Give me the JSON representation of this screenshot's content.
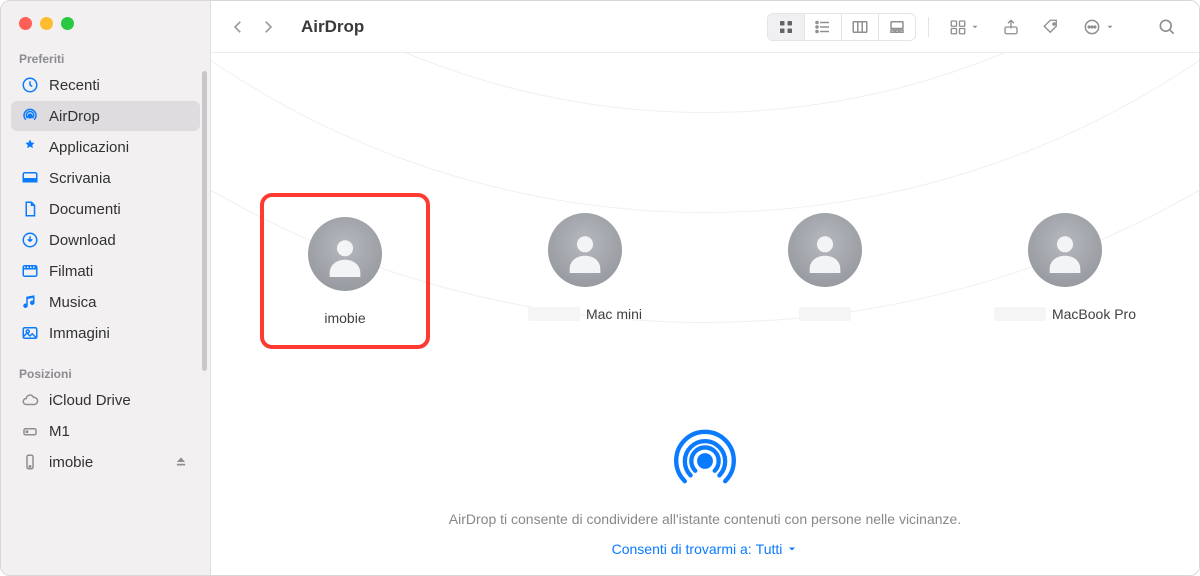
{
  "window": {
    "title": "AirDrop"
  },
  "sidebar": {
    "sections": [
      {
        "label": "Preferiti",
        "items": [
          {
            "icon": "clock-icon",
            "label": "Recenti",
            "active": false
          },
          {
            "icon": "airdrop-icon",
            "label": "AirDrop",
            "active": true
          },
          {
            "icon": "apps-icon",
            "label": "Applicazioni",
            "active": false
          },
          {
            "icon": "desktop-icon",
            "label": "Scrivania",
            "active": false
          },
          {
            "icon": "doc-icon",
            "label": "Documenti",
            "active": false
          },
          {
            "icon": "download-icon",
            "label": "Download",
            "active": false
          },
          {
            "icon": "movie-icon",
            "label": "Filmati",
            "active": false
          },
          {
            "icon": "music-icon",
            "label": "Musica",
            "active": false
          },
          {
            "icon": "image-icon",
            "label": "Immagini",
            "active": false
          }
        ]
      },
      {
        "label": "Posizioni",
        "items": [
          {
            "icon": "cloud-icon",
            "label": "iCloud Drive",
            "active": false,
            "gray": true
          },
          {
            "icon": "disk-icon",
            "label": "M1",
            "active": false,
            "gray": true
          },
          {
            "icon": "iphone-icon",
            "label": "imobie",
            "active": false,
            "gray": true,
            "eject": true
          }
        ]
      }
    ]
  },
  "devices": [
    {
      "label": "imobie",
      "highlight": true
    },
    {
      "label": "Mac mini",
      "blurred_prefix": true
    },
    {
      "label": "",
      "blurred_prefix": true
    },
    {
      "label": "MacBook Pro",
      "blurred_prefix": true
    }
  ],
  "info": {
    "text": "AirDrop ti consente di condividere all'istante contenuti con persone nelle vicinanze.",
    "visibility_prefix": "Consenti di trovarmi a:",
    "visibility_value": "Tutti"
  },
  "colors": {
    "accent": "#0a7aff",
    "highlight_border": "#ff3a30"
  }
}
